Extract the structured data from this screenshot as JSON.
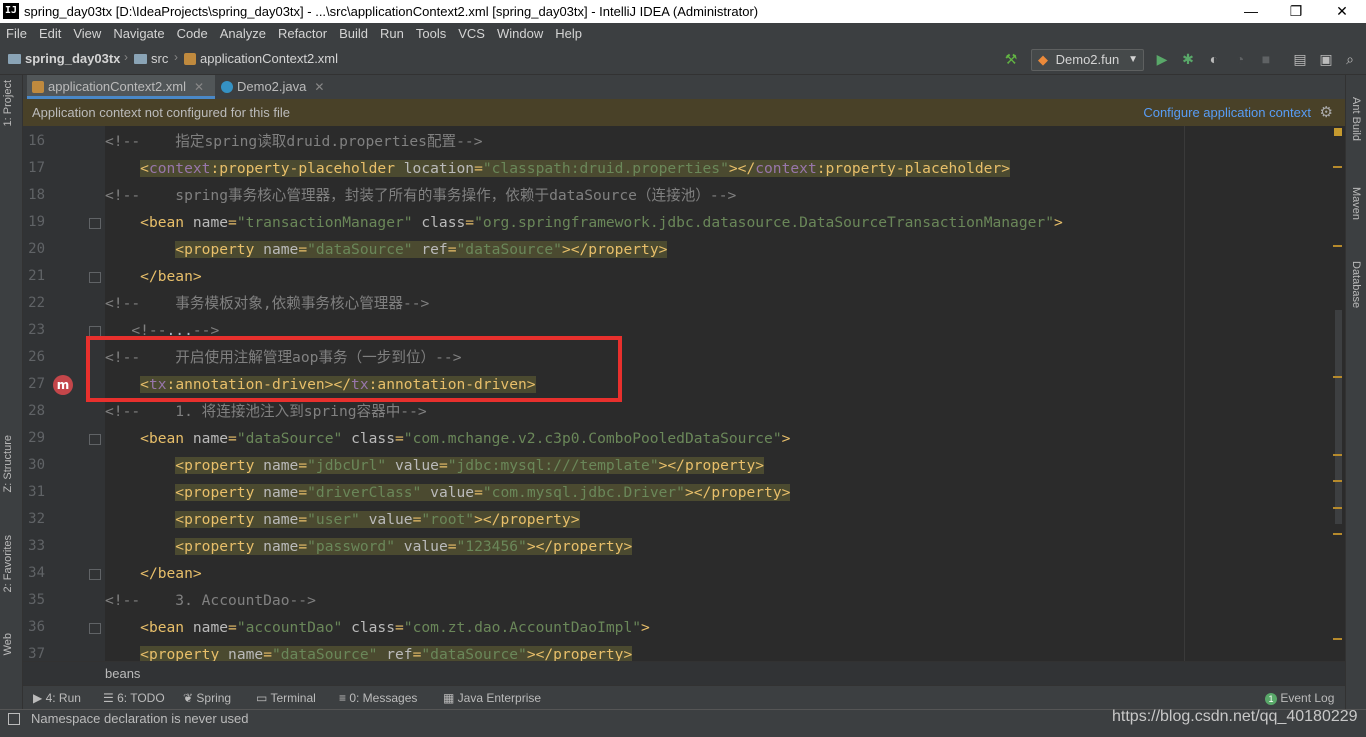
{
  "window": {
    "title": "spring_day03tx [D:\\IdeaProjects\\spring_day03tx] - ...\\src\\applicationContext2.xml [spring_day03tx] - IntelliJ IDEA (Administrator)",
    "logo": "IJ",
    "minimize": "—",
    "maximize": "❐",
    "close": "✕"
  },
  "menu": [
    "File",
    "Edit",
    "View",
    "Navigate",
    "Code",
    "Analyze",
    "Refactor",
    "Build",
    "Run",
    "Tools",
    "VCS",
    "Window",
    "Help"
  ],
  "navbar": {
    "project": "spring_day03tx",
    "folder": "src",
    "file": "applicationContext2.xml",
    "run_config": "Demo2.fun"
  },
  "tabs": [
    {
      "label": "applicationContext2.xml",
      "active": true
    },
    {
      "label": "Demo2.java",
      "active": false
    }
  ],
  "banner": {
    "message": "Application context not configured for this file",
    "link": "Configure application context"
  },
  "left_tools": [
    "1: Project",
    "Z: Structure",
    "2: Favorites",
    "Web"
  ],
  "right_tools": [
    "Ant Build",
    "Maven",
    "Database"
  ],
  "editor": {
    "lines": [
      {
        "n": "16",
        "segs": [
          [
            "cm",
            "<!--    指定spring读取druid.properties配置-->"
          ]
        ]
      },
      {
        "n": "17",
        "hl": true,
        "segs": [
          [
            "tx",
            "    "
          ],
          [
            "tg",
            "<"
          ],
          [
            "ns",
            "context"
          ],
          [
            "tg",
            ":property-placeholder "
          ],
          [
            "at",
            "location"
          ],
          [
            "tg",
            "="
          ],
          [
            "vl",
            "\"classpath:druid.properties\""
          ],
          [
            "tg",
            "></"
          ],
          [
            "ns",
            "context"
          ],
          [
            "tg",
            ":property-placeholder>"
          ]
        ]
      },
      {
        "n": "18",
        "segs": [
          [
            "cm",
            "<!--    spring事务核心管理器，封装了所有的事务操作，依赖于dataSource（连接池）-->"
          ]
        ]
      },
      {
        "n": "19",
        "segs": [
          [
            "tx",
            "    "
          ],
          [
            "tg",
            "<bean "
          ],
          [
            "at",
            "name"
          ],
          [
            "tg",
            "="
          ],
          [
            "vl",
            "\"transactionManager\""
          ],
          [
            "tg",
            " "
          ],
          [
            "at",
            "class"
          ],
          [
            "tg",
            "="
          ],
          [
            "vl",
            "\"org.springframework.jdbc.datasource.DataSourceTransactionManager\""
          ],
          [
            "tg",
            ">"
          ]
        ]
      },
      {
        "n": "20",
        "hl": true,
        "segs": [
          [
            "tx",
            "        "
          ],
          [
            "tg",
            "<property "
          ],
          [
            "at",
            "name"
          ],
          [
            "tg",
            "="
          ],
          [
            "vl",
            "\"dataSource\""
          ],
          [
            "tg",
            " "
          ],
          [
            "at",
            "ref"
          ],
          [
            "tg",
            "="
          ],
          [
            "vl",
            "\"dataSource\""
          ],
          [
            "tg",
            "></property>"
          ]
        ]
      },
      {
        "n": "21",
        "segs": [
          [
            "tx",
            "    "
          ],
          [
            "tg",
            "</bean>"
          ]
        ]
      },
      {
        "n": "22",
        "segs": [
          [
            "cm",
            "<!--    事务模板对象,依赖事务核心管理器-->"
          ]
        ]
      },
      {
        "n": "23",
        "segs": [
          [
            "tx",
            "   "
          ],
          [
            "cm",
            "<!--"
          ],
          [
            "tx",
            "..."
          ],
          [
            "cm",
            "-->"
          ]
        ]
      },
      {
        "n": "26",
        "segs": [
          [
            "cm",
            "<!--    开启使用注解管理aop事务（一步到位）-->"
          ]
        ]
      },
      {
        "n": "27",
        "hl": true,
        "segs": [
          [
            "tx",
            "    "
          ],
          [
            "tg",
            "<"
          ],
          [
            "ns",
            "tx"
          ],
          [
            "tg",
            ":annotation-driven></"
          ],
          [
            "ns",
            "tx"
          ],
          [
            "tg",
            ":annotation-driven>"
          ]
        ]
      },
      {
        "n": "28",
        "segs": [
          [
            "cm",
            "<!--    1. 将连接池注入到spring容器中-->"
          ]
        ]
      },
      {
        "n": "29",
        "segs": [
          [
            "tx",
            "    "
          ],
          [
            "tg",
            "<bean "
          ],
          [
            "at",
            "name"
          ],
          [
            "tg",
            "="
          ],
          [
            "vl",
            "\"dataSource\""
          ],
          [
            "tg",
            " "
          ],
          [
            "at",
            "class"
          ],
          [
            "tg",
            "="
          ],
          [
            "vl",
            "\"com.mchange.v2.c3p0.ComboPooledDataSource\""
          ],
          [
            "tg",
            ">"
          ]
        ]
      },
      {
        "n": "30",
        "hl": true,
        "segs": [
          [
            "tx",
            "        "
          ],
          [
            "tg",
            "<property "
          ],
          [
            "at",
            "name"
          ],
          [
            "tg",
            "="
          ],
          [
            "vl",
            "\"jdbcUrl\""
          ],
          [
            "tg",
            " "
          ],
          [
            "at",
            "value"
          ],
          [
            "tg",
            "="
          ],
          [
            "vl",
            "\"jdbc:mysql:///template\""
          ],
          [
            "tg",
            "></property>"
          ]
        ]
      },
      {
        "n": "31",
        "hl": true,
        "segs": [
          [
            "tx",
            "        "
          ],
          [
            "tg",
            "<property "
          ],
          [
            "at",
            "name"
          ],
          [
            "tg",
            "="
          ],
          [
            "vl",
            "\"driverClass\""
          ],
          [
            "tg",
            " "
          ],
          [
            "at",
            "value"
          ],
          [
            "tg",
            "="
          ],
          [
            "vl",
            "\"com.mysql.jdbc.Driver\""
          ],
          [
            "tg",
            "></property>"
          ]
        ]
      },
      {
        "n": "32",
        "hl": true,
        "segs": [
          [
            "tx",
            "        "
          ],
          [
            "tg",
            "<property "
          ],
          [
            "at",
            "name"
          ],
          [
            "tg",
            "="
          ],
          [
            "vl",
            "\"user\""
          ],
          [
            "tg",
            " "
          ],
          [
            "at",
            "value"
          ],
          [
            "tg",
            "="
          ],
          [
            "vl",
            "\"root\""
          ],
          [
            "tg",
            "></property>"
          ]
        ]
      },
      {
        "n": "33",
        "hl": true,
        "segs": [
          [
            "tx",
            "        "
          ],
          [
            "tg",
            "<property "
          ],
          [
            "at",
            "name"
          ],
          [
            "tg",
            "="
          ],
          [
            "vl",
            "\"password\""
          ],
          [
            "tg",
            " "
          ],
          [
            "at",
            "value"
          ],
          [
            "tg",
            "="
          ],
          [
            "vl",
            "\"123456\""
          ],
          [
            "tg",
            "></property>"
          ]
        ]
      },
      {
        "n": "34",
        "segs": [
          [
            "tx",
            "    "
          ],
          [
            "tg",
            "</bean>"
          ]
        ]
      },
      {
        "n": "35",
        "segs": [
          [
            "cm",
            "<!--    3. AccountDao-->"
          ]
        ]
      },
      {
        "n": "36",
        "segs": [
          [
            "tx",
            "    "
          ],
          [
            "tg",
            "<bean "
          ],
          [
            "at",
            "name"
          ],
          [
            "tg",
            "="
          ],
          [
            "vl",
            "\"accountDao\""
          ],
          [
            "tg",
            " "
          ],
          [
            "at",
            "class"
          ],
          [
            "tg",
            "="
          ],
          [
            "vl",
            "\"com.zt.dao.AccountDaoImpl\""
          ],
          [
            "tg",
            ">"
          ]
        ]
      },
      {
        "n": "37",
        "hl": true,
        "segs": [
          [
            "tx",
            "    "
          ],
          [
            "tg",
            "<property "
          ],
          [
            "at",
            "name"
          ],
          [
            "tg",
            "="
          ],
          [
            "vl",
            "\"dataSource\""
          ],
          [
            "tg",
            " "
          ],
          [
            "at",
            "ref"
          ],
          [
            "tg",
            "="
          ],
          [
            "vl",
            "\"dataSource\""
          ],
          [
            "tg",
            "></property>"
          ]
        ]
      }
    ],
    "breadcrumb": "beans"
  },
  "bottom_tools": [
    {
      "label": "4: Run",
      "icon": "run-icon"
    },
    {
      "label": "6: TODO",
      "icon": "todo-icon"
    },
    {
      "label": "Spring",
      "icon": "spring-icon"
    },
    {
      "label": "Terminal",
      "icon": "terminal-icon"
    },
    {
      "label": "0: Messages",
      "icon": "messages-icon"
    },
    {
      "label": "Java Enterprise",
      "icon": "java-enterprise-icon"
    }
  ],
  "event_log": {
    "label": "Event Log",
    "count": "1"
  },
  "status": {
    "message": "Namespace declaration is never used",
    "watermark": "https://blog.csdn.net/qq_40180229"
  },
  "colors": {
    "highlight_box": "#e8302d",
    "tag": "#e8bf6a",
    "string": "#6a8759",
    "comment": "#808080"
  }
}
